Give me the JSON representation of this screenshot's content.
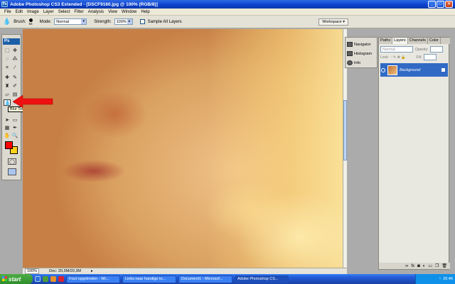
{
  "window": {
    "title": "Adobe Photoshop CS3 Extended - [DSCF9160.jpg @ 100% (RGB/8)]",
    "controls": {
      "minimize": "_",
      "maximize": "□",
      "close": "×"
    }
  },
  "menu": [
    "File",
    "Edit",
    "Image",
    "Layer",
    "Select",
    "Filter",
    "Analysis",
    "View",
    "Window",
    "Help"
  ],
  "options": {
    "brush_label": "Brush:",
    "brush_size": "64",
    "mode_label": "Mode:",
    "mode_value": "Normal",
    "strength_label": "Strength:",
    "strength_value": "100%",
    "sample_all_layers": "Sample All Layers",
    "workspace": "Workspace"
  },
  "toolbox": {
    "logo": "Ps",
    "tooltip": "Blur Tool (R)",
    "foreground_color": "#ff0000",
    "background_color": "#ffd21a"
  },
  "statusbar": {
    "zoom": "100%",
    "doc": "Doc: 20,3M/20,3M"
  },
  "dock": {
    "items": [
      "Navigator",
      "Histogram",
      "Info"
    ]
  },
  "layers": {
    "tabs": [
      "Paths",
      "Layers",
      "Channels",
      "Color"
    ],
    "active_tab": "Layers",
    "blend_mode": "Normal",
    "opacity_label": "Opacity:",
    "lock_label": "Lock:",
    "fill_label": "Fill:",
    "layer_name": "Background"
  },
  "taskbar": {
    "start": "start",
    "tasks": [
      "Fout opgetreden - Wi...",
      "Links naar handige to...",
      "Document1 - Microsof...",
      "Adobe Photoshop CS..."
    ],
    "clock": "20:46"
  }
}
